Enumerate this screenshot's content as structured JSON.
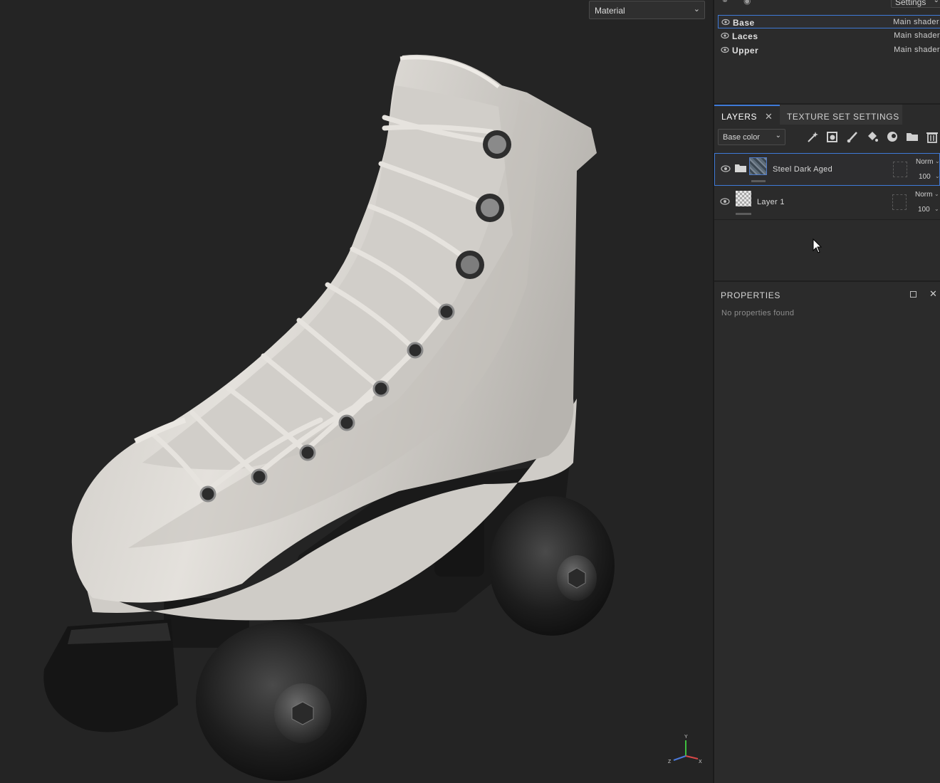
{
  "viewport": {
    "mode_label": "Material",
    "gizmo": {
      "y": "Y",
      "x": "X",
      "z": "Z"
    }
  },
  "texture_sets": {
    "settings_label": "Settings",
    "items": [
      {
        "name": "Base",
        "shader": "Main shader",
        "selected": true
      },
      {
        "name": "Laces",
        "shader": "Main shader",
        "selected": false
      },
      {
        "name": "Upper",
        "shader": "Main shader",
        "selected": false
      }
    ]
  },
  "tabs": {
    "layers": "LAYERS",
    "texture_set_settings": "TEXTURE SET SETTINGS"
  },
  "layers_toolbar": {
    "channel": "Base color",
    "icons": [
      "magic-wand-icon",
      "add-mask-icon",
      "paint-brush-icon",
      "fill-bucket-icon",
      "smart-material-icon",
      "folder-icon",
      "trash-icon"
    ]
  },
  "layers": [
    {
      "name": "Steel Dark Aged",
      "blend": "Norm",
      "opacity": "100",
      "type": "folder",
      "selected": true
    },
    {
      "name": "Layer 1",
      "blend": "Norm",
      "opacity": "100",
      "type": "paint",
      "selected": false
    }
  ],
  "properties": {
    "title": "PROPERTIES",
    "empty_text": "No properties found"
  },
  "colors": {
    "accent": "#3f7ad8",
    "panel": "#2b2b2b",
    "viewport_bg": "#242424",
    "boot": "#d8d5d0",
    "wheel": "#222222"
  }
}
